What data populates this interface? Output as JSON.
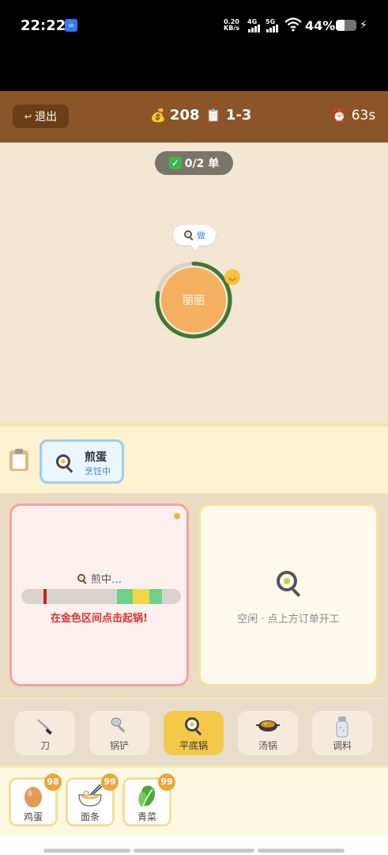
{
  "status_bar": {
    "time": "22:22",
    "app_badge": "☕",
    "net_speed_top": "0.20",
    "net_speed_bottom": "KB/s",
    "sig1": "4G",
    "sig2": "5G",
    "battery": "44%",
    "battery_level": 0.44,
    "charging_icon": "bolt-icon"
  },
  "header": {
    "exit_label": "退出",
    "exit_icon": "↩",
    "coins_icon": "💰",
    "coins": "208",
    "level_icon": "📋",
    "level": "1-3",
    "timer_icon": "⏰",
    "timer": "63s",
    "color": "#8b5527"
  },
  "game": {
    "orders_done": "0/2 单",
    "customer": {
      "name": "丽丽",
      "request_text": "做",
      "patience": 0.78,
      "mood_icon": "😊"
    }
  },
  "order_strip": {
    "orders": [
      {
        "name": "煎蛋",
        "status": "烹饪中"
      }
    ]
  },
  "stations": {
    "active": {
      "label": "煎中…",
      "hint": "在金色区间点击起锅!",
      "needle": 0.14,
      "zones": [
        {
          "from": 0.6,
          "to": 0.7,
          "color": "#6fd08a"
        },
        {
          "from": 0.7,
          "to": 0.8,
          "color": "#f2d64a"
        },
        {
          "from": 0.8,
          "to": 0.88,
          "color": "#6fd08a"
        }
      ]
    },
    "idle": {
      "text": "空闲 · 点上方订单开工"
    }
  },
  "tools": [
    {
      "label": "刀",
      "icon": "knife-icon",
      "active": false
    },
    {
      "label": "锅铲",
      "icon": "spatula-icon",
      "active": false
    },
    {
      "label": "平底锅",
      "icon": "frying-pan-icon",
      "active": true
    },
    {
      "label": "汤锅",
      "icon": "soup-pot-icon",
      "active": false
    },
    {
      "label": "调料",
      "icon": "salt-shaker-icon",
      "active": false
    }
  ],
  "ingredients": [
    {
      "label": "鸡蛋",
      "count": "98",
      "icon": "egg-icon"
    },
    {
      "label": "面条",
      "count": "99",
      "icon": "noodles-icon"
    },
    {
      "label": "青菜",
      "count": "99",
      "icon": "greens-icon"
    }
  ]
}
